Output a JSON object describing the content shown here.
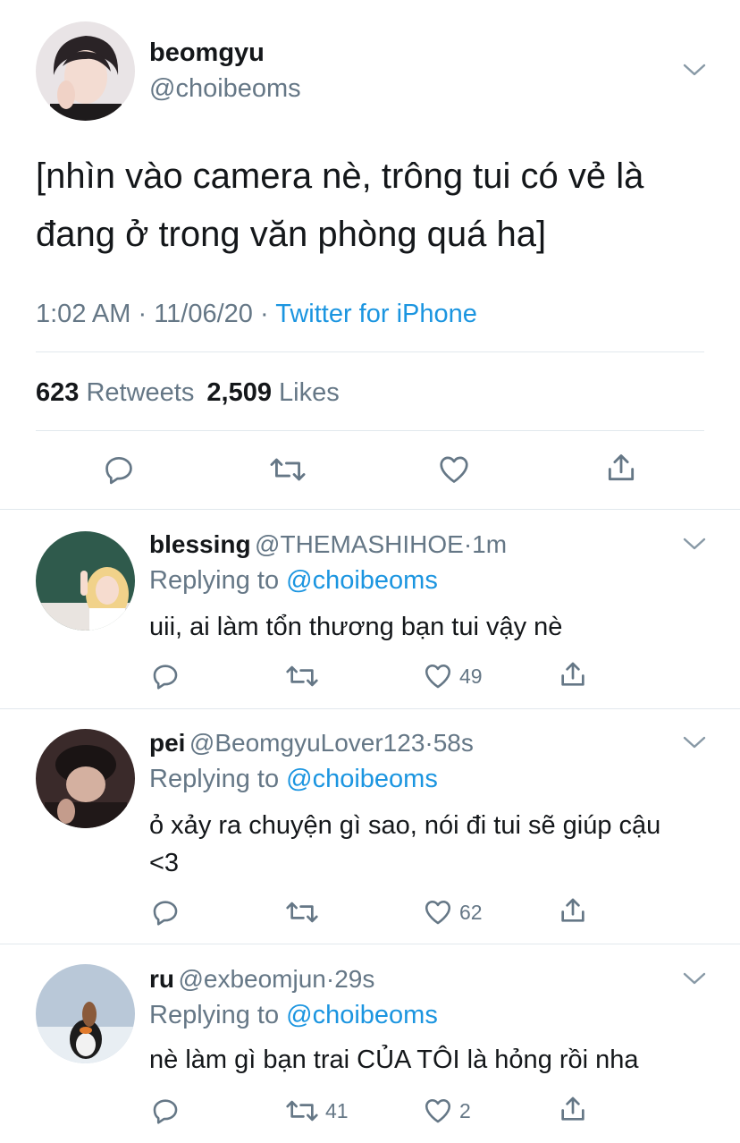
{
  "main_tweet": {
    "author_name": "beomgyu",
    "author_handle": "@choibeoms",
    "text_line1": "[nhìn vào camera nè, trông tui có vẻ là",
    "text_line2": "đang ở trong văn phòng quá ha]",
    "time": "1:02 AM",
    "date": "11/06/20",
    "separator": "·",
    "source": "Twitter for iPhone",
    "retweets_count": "623",
    "retweets_label": "Retweets",
    "likes_count": "2,509",
    "likes_label": "Likes"
  },
  "replies": [
    {
      "name": "blessing",
      "handle": "@THEMASHIHOE",
      "dot": "·",
      "age": "1m",
      "replying_label": "Replying to",
      "replying_to": "@choibeoms",
      "text": "uii, ai làm tổn thương bạn tui vậy nè",
      "retweets": "",
      "likes": "49"
    },
    {
      "name": "pei",
      "handle": "@BeomgyuLover123",
      "dot": "·",
      "age": "58s",
      "replying_label": "Replying to",
      "replying_to": "@choibeoms",
      "text": "ỏ xảy ra chuyện gì sao, nói đi tui sẽ giúp cậu <3",
      "retweets": "",
      "likes": "62"
    },
    {
      "name": "ru",
      "handle": "@exbeomjun",
      "dot": "·",
      "age": "29s",
      "replying_label": "Replying to",
      "replying_to": "@choibeoms",
      "text": "nè làm gì bạn trai CỦA TÔI là hỏng rồi nha",
      "retweets": "41",
      "likes": "2"
    }
  ],
  "icons": {
    "reply": "reply-icon",
    "retweet": "retweet-icon",
    "like": "heart-icon",
    "share": "share-icon",
    "more": "chevron-down-icon"
  },
  "colors": {
    "text": "#14171a",
    "secondary": "#657786",
    "link": "#1b95e0",
    "divider": "#e1e8ed"
  }
}
